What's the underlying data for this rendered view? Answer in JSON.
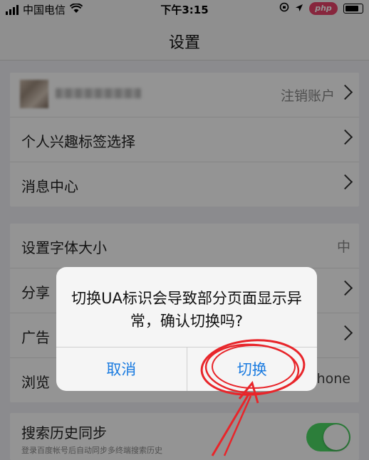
{
  "status_bar": {
    "carrier": "中国电信",
    "time": "下午3:15",
    "watermark": "php"
  },
  "nav": {
    "title": "设置"
  },
  "account": {
    "action_label": "注销账户"
  },
  "group1": [
    {
      "label": "个人兴趣标签选择"
    },
    {
      "label": "消息中心"
    }
  ],
  "group2": [
    {
      "label": "设置字体大小",
      "value": "中"
    },
    {
      "label": "分享"
    },
    {
      "label": "广告"
    },
    {
      "label": "浏览",
      "value": "hone"
    }
  ],
  "sync": {
    "label": "搜索历史同步",
    "description": "登录百度帐号后自动同步多终端搜索历史",
    "enabled": true
  },
  "dialog": {
    "message": "切换UA标识会导致部分页面显示异常，确认切换吗?",
    "cancel_label": "取消",
    "confirm_label": "切换"
  },
  "colors": {
    "accent": "#1a7be0",
    "toggle_on": "#4cd964",
    "annotation": "#e8252a"
  }
}
